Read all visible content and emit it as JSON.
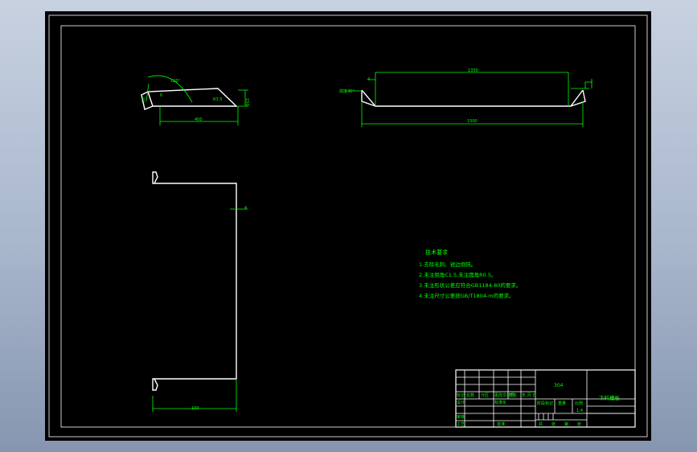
{
  "colors": {
    "background": "#000000",
    "outline": "#ffffff",
    "annotation": "#00ff00"
  },
  "top_view": {
    "angle_label": "120°",
    "small_dim_left": "15",
    "small_dim_mid": "6",
    "bend_label": "R3.5",
    "height_dim": "150",
    "width_dim": "400"
  },
  "front_view": {
    "angle_label": "焊接45°",
    "thickness_label": "4",
    "top_dim": "1350",
    "bottom_dim": "1500"
  },
  "side_view": {
    "thickness_label": "4",
    "width_dim": "100"
  },
  "tech_requirements": {
    "title": "技术要求",
    "items": [
      "1.去除毛刺、锐边倒钝。",
      "2.未注倒角C1.5,未注圆角R0.5。",
      "3.未注形状公差应符合GB1184-80的要求。",
      "4.未注尺寸公差按GB/T1804-m的要求。"
    ]
  },
  "title_block": {
    "material": "304",
    "part_name": "下料槽板",
    "scale_label": "比例",
    "scale_value": "1:4",
    "row_labels": [
      "标记",
      "处数",
      "分区",
      "更改文件号",
      "签名",
      "年.月.日"
    ],
    "role_labels": [
      "设计",
      "审核",
      "工艺"
    ],
    "std_label": "标准化",
    "approve_label": "批准",
    "stage_label": "阶段标记",
    "weight_label": "重量",
    "sheet_labels": [
      "共",
      "张",
      "第",
      "张"
    ]
  }
}
